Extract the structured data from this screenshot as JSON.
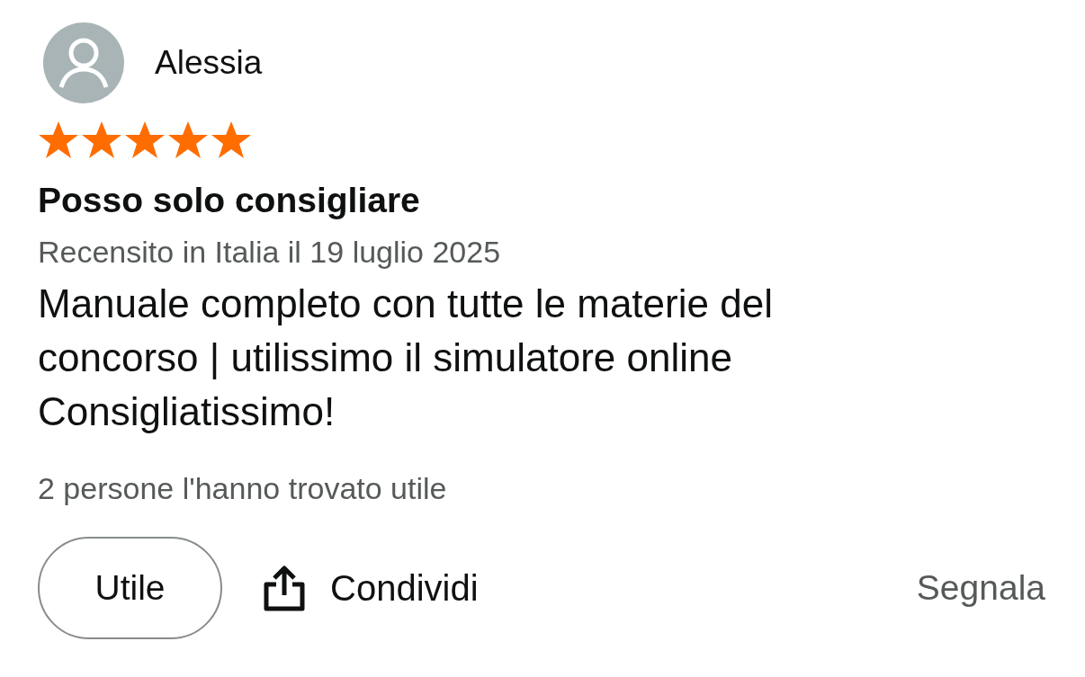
{
  "review": {
    "author": "Alessia",
    "stars": 5,
    "title": "Posso solo consigliare",
    "date": "Recensito in Italia il 19 luglio 2025",
    "body": "Manuale completo con tutte le materie del concorso | utilissimo il simulatore online\nConsigliatissimo!",
    "helpful_count": "2 persone l'hanno trovato utile"
  },
  "actions": {
    "helpful_button": "Utile",
    "share_button": "Condividi",
    "report_link": "Segnala"
  }
}
